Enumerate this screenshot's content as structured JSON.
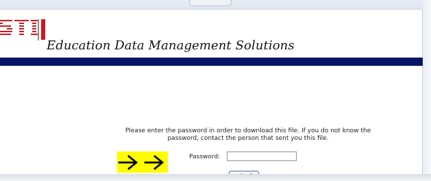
{
  "header": {
    "logo_text": "STI",
    "title": "Education Data Management Solutions"
  },
  "download": {
    "instructions": "Please enter the password in order to download this file. If you do not know the password, contact the person that sent you this file.",
    "password_label": "Password:",
    "password_value": "",
    "submit_label": "submit"
  },
  "annotation": {
    "arrow_color": "#000000",
    "highlight_color": "#fffc00"
  },
  "colors": {
    "brand_red": "#d4151b",
    "rule_blue": "#061466"
  }
}
